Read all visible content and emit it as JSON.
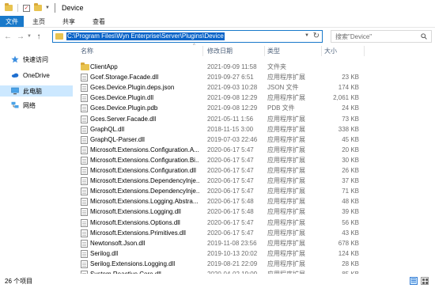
{
  "window": {
    "title": "Device"
  },
  "ribbon": {
    "tabs": [
      "文件",
      "主页",
      "共享",
      "查看"
    ]
  },
  "address": {
    "path": "C:\\Program Files\\Wyn Enterprise\\Server\\Plugins\\Device",
    "search_placeholder": "搜索\"Device\""
  },
  "sidebar": {
    "items": [
      {
        "label": "快速访问",
        "icon": "star-icon"
      },
      {
        "label": "OneDrive",
        "icon": "cloud-icon"
      },
      {
        "label": "此电脑",
        "icon": "computer-icon"
      },
      {
        "label": "网络",
        "icon": "network-icon"
      }
    ]
  },
  "columns": {
    "name": "名称",
    "date": "修改日期",
    "type": "类型",
    "size": "大小"
  },
  "files": [
    {
      "name": "ClientApp",
      "date": "2021-09-09 11:58",
      "type": "文件夹",
      "size": "",
      "icon": "folder"
    },
    {
      "name": "Gcef.Storage.Facade.dll",
      "date": "2019-09-27 6:51",
      "type": "应用程序扩展",
      "size": "23 KB",
      "icon": "file"
    },
    {
      "name": "Gces.Device.Plugin.deps.json",
      "date": "2021-09-03 10:28",
      "type": "JSON 文件",
      "size": "174 KB",
      "icon": "file"
    },
    {
      "name": "Gces.Device.Plugin.dll",
      "date": "2021-09-08 12:29",
      "type": "应用程序扩展",
      "size": "2,061 KB",
      "icon": "file"
    },
    {
      "name": "Gces.Device.Plugin.pdb",
      "date": "2021-09-08 12:29",
      "type": "PDB 文件",
      "size": "24 KB",
      "icon": "file"
    },
    {
      "name": "Gces.Server.Facade.dll",
      "date": "2021-05-11 1:56",
      "type": "应用程序扩展",
      "size": "73 KB",
      "icon": "file"
    },
    {
      "name": "GraphQL.dll",
      "date": "2018-11-15 3:00",
      "type": "应用程序扩展",
      "size": "338 KB",
      "icon": "file"
    },
    {
      "name": "GraphQL-Parser.dll",
      "date": "2019-07-03 22:46",
      "type": "应用程序扩展",
      "size": "45 KB",
      "icon": "file"
    },
    {
      "name": "Microsoft.Extensions.Configuration.A...",
      "date": "2020-06-17 5:47",
      "type": "应用程序扩展",
      "size": "20 KB",
      "icon": "file"
    },
    {
      "name": "Microsoft.Extensions.Configuration.Bi...",
      "date": "2020-06-17 5:47",
      "type": "应用程序扩展",
      "size": "30 KB",
      "icon": "file"
    },
    {
      "name": "Microsoft.Extensions.Configuration.dll",
      "date": "2020-06-17 5:47",
      "type": "应用程序扩展",
      "size": "26 KB",
      "icon": "file"
    },
    {
      "name": "Microsoft.Extensions.DependencyInje...",
      "date": "2020-06-17 5:47",
      "type": "应用程序扩展",
      "size": "37 KB",
      "icon": "file"
    },
    {
      "name": "Microsoft.Extensions.DependencyInje...",
      "date": "2020-06-17 5:47",
      "type": "应用程序扩展",
      "size": "71 KB",
      "icon": "file"
    },
    {
      "name": "Microsoft.Extensions.Logging.Abstra...",
      "date": "2020-06-17 5:48",
      "type": "应用程序扩展",
      "size": "48 KB",
      "icon": "file"
    },
    {
      "name": "Microsoft.Extensions.Logging.dll",
      "date": "2020-06-17 5:48",
      "type": "应用程序扩展",
      "size": "39 KB",
      "icon": "file"
    },
    {
      "name": "Microsoft.Extensions.Options.dll",
      "date": "2020-06-17 5:47",
      "type": "应用程序扩展",
      "size": "56 KB",
      "icon": "file"
    },
    {
      "name": "Microsoft.Extensions.Primitives.dll",
      "date": "2020-06-17 5:47",
      "type": "应用程序扩展",
      "size": "43 KB",
      "icon": "file"
    },
    {
      "name": "Newtonsoft.Json.dll",
      "date": "2019-11-08 23:56",
      "type": "应用程序扩展",
      "size": "678 KB",
      "icon": "file"
    },
    {
      "name": "Serilog.dll",
      "date": "2019-10-13 20:02",
      "type": "应用程序扩展",
      "size": "124 KB",
      "icon": "file"
    },
    {
      "name": "Serilog.Extensions.Logging.dll",
      "date": "2019-08-21 22:09",
      "type": "应用程序扩展",
      "size": "28 KB",
      "icon": "file"
    },
    {
      "name": "System.Reactive.Core.dll",
      "date": "2020-04-02 19:09",
      "type": "应用程序扩展",
      "size": "85 KB",
      "icon": "file"
    }
  ],
  "status": {
    "count_text": "26 个项目"
  },
  "colors": {
    "accent": "#1979ca",
    "selected": "#cce8ff"
  }
}
